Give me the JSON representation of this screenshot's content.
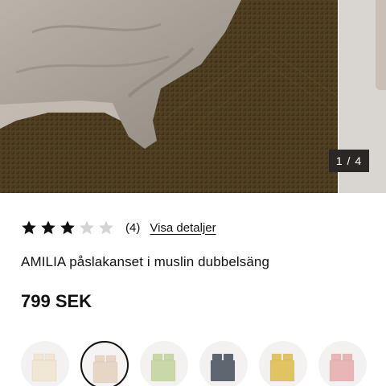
{
  "gallery": {
    "counter": "1 / 4",
    "image_alt": "icon-duvet-on-rug-photo"
  },
  "rating": {
    "value": 3,
    "max": 5,
    "count": "(4)",
    "details_link": "Visa detaljer"
  },
  "product": {
    "title": "AMILIA påslakanset i muslin dubbelsäng",
    "price": "799 SEK"
  },
  "colors": {
    "selected_index": 1,
    "options": [
      {
        "color": "#efe6d3"
      },
      {
        "color": "#e6d6c6"
      },
      {
        "color": "#c9d8a6"
      },
      {
        "color": "#5f6670"
      },
      {
        "color": "#e1c462"
      },
      {
        "color": "#e8b6b6"
      }
    ]
  }
}
